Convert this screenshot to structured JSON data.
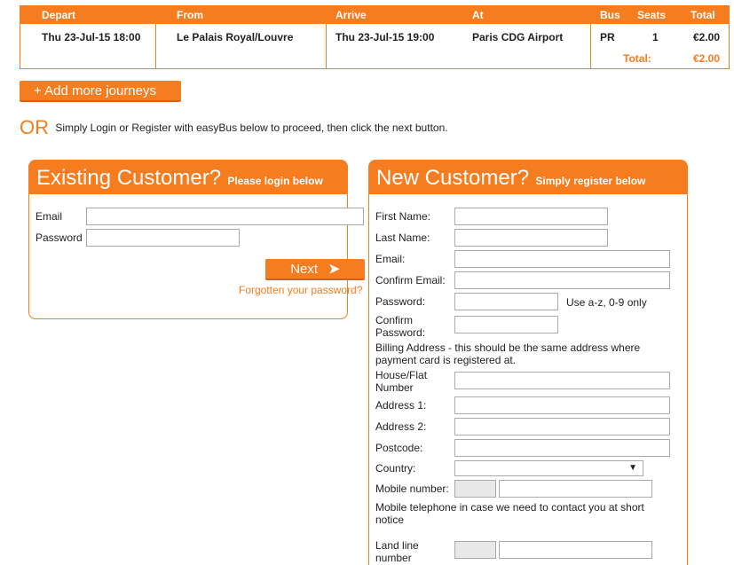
{
  "journey": {
    "headers": {
      "depart": "Depart",
      "from": "From",
      "arrive": "Arrive",
      "at": "At",
      "bus": "Bus",
      "seats": "Seats",
      "total": "Total"
    },
    "row": {
      "depart": "Thu 23-Jul-15 18:00",
      "from": "Le Palais Royal/Louvre",
      "arrive": "Thu 23-Jul-15 19:00",
      "at": "Paris CDG Airport",
      "bus": "PR",
      "seats": "1",
      "total": "€2.00"
    },
    "total_label": "Total:",
    "total_value": "€2.00"
  },
  "add_journeys": "+ Add more journeys",
  "or": {
    "big": "OR",
    "text": "Simply Login or Register with easyBus below to proceed, then click the next button."
  },
  "login": {
    "title": "Existing Customer?",
    "subtitle": "Please login below",
    "email_label": "Email",
    "password_label": "Password",
    "next_label": "Next",
    "forgot": "Forgotten your password?"
  },
  "register": {
    "title": "New Customer?",
    "subtitle": "Simply register below",
    "first_name": "First Name:",
    "last_name": "Last Name:",
    "email": "Email:",
    "confirm_email": "Confirm Email:",
    "password": "Password:",
    "password_hint": "Use a-z, 0-9 only",
    "confirm_password": "Confirm Password:",
    "billing_note": "Billing Address - this should be the same address where payment card is registered at.",
    "house": "House/Flat Number",
    "address1": "Address 1:",
    "address2": "Address 2:",
    "postcode": "Postcode:",
    "country": "Country:",
    "mobile": "Mobile number:",
    "mobile_note": "Mobile telephone in case we need to contact you at short notice",
    "landline": "Land line number"
  },
  "colors": {
    "accent": "#f57c1f"
  }
}
